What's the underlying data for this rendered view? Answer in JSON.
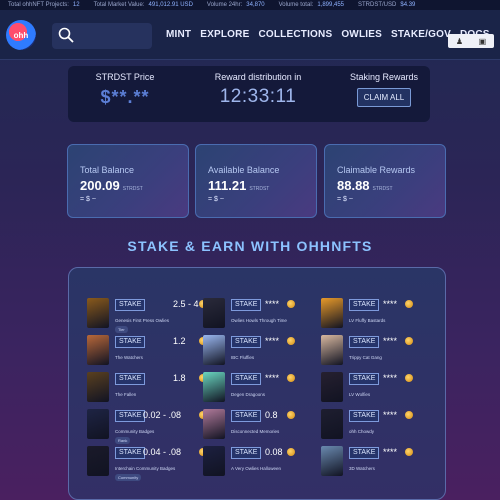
{
  "ticker": {
    "items": [
      {
        "label": "Total ohhNFT Projects:",
        "value": "12"
      },
      {
        "label": "Total Market Value:",
        "value": "491,012.91 USD"
      },
      {
        "label": "Volume 24hr:",
        "value": "34,870"
      },
      {
        "label": "Volume total:",
        "value": "1,899,455"
      },
      {
        "label": "STRDST/USD",
        "value": "$4.39"
      }
    ]
  },
  "header": {
    "logo_text": "ohh",
    "nav": [
      "MINT",
      "EXPLORE",
      "COLLECTIONS",
      "OWLIES",
      "STAKE/GOV",
      "DOCS"
    ],
    "icons": [
      "user-icon",
      "lock-icon"
    ]
  },
  "staking": {
    "price_label": "STRDST Price",
    "price_value": "$**.**",
    "reward_label": "Reward distribution in",
    "reward_value": "12:33:11",
    "rewards_label": "Staking Rewards",
    "claim_label": "CLAIM ALL"
  },
  "balances": [
    {
      "title": "Total Balance",
      "amount": "200.09",
      "unit": "STRDST",
      "usd": "= $ ~"
    },
    {
      "title": "Available Balance",
      "amount": "111.21",
      "unit": "STRDST",
      "usd": "= $ ~"
    },
    {
      "title": "Claimable Rewards",
      "amount": "88.88",
      "unit": "STRDST",
      "usd": "= $ ~"
    }
  ],
  "section_title": "STAKE & EARN WITH OHHNFTS",
  "stake_label": "STAKE",
  "collections": [
    {
      "name": "Genesis First Press Owlies",
      "rate": "2.5 - 4",
      "tag": "Tier",
      "color": "#8a5a1c"
    },
    {
      "name": "The Watchers",
      "rate": "1.2",
      "tag": "",
      "color": "#b8683a"
    },
    {
      "name": "The Fallen",
      "rate": "1.8",
      "tag": "",
      "color": "#5a4020"
    },
    {
      "name": "Community Badges",
      "rate": "0.02 - .08",
      "tag": "Rank",
      "color": "#1e2444"
    },
    {
      "name": "Interchain Community Badges",
      "rate": "0.04 - .08",
      "tag": "Community",
      "color": "#1a1a2a"
    },
    {
      "name": "Owlies Howls Through Time",
      "rate": "****",
      "tag": "",
      "color": "#2a2a3a"
    },
    {
      "name": "IBC Fluffies",
      "rate": "****",
      "tag": "",
      "color": "#9ab7f0"
    },
    {
      "name": "Degen Dragoons",
      "rate": "****",
      "tag": "",
      "color": "#6ad6c0"
    },
    {
      "name": "Disconnected Memories",
      "rate": "0.8",
      "tag": "",
      "color": "#b07a9a"
    },
    {
      "name": "A Very Owlies Halloween",
      "rate": "0.08",
      "tag": "",
      "color": "#1c2040"
    },
    {
      "name": "LV Fluffy Bastards",
      "rate": "****",
      "tag": "",
      "color": "#e89a2a"
    },
    {
      "name": "Trippy Cat Gang",
      "rate": "****",
      "tag": "",
      "color": "#d8b8a0"
    },
    {
      "name": "LV Wolfies",
      "rate": "****",
      "tag": "",
      "color": "#262030"
    },
    {
      "name": "ohh Chowdy",
      "rate": "****",
      "tag": "",
      "color": "#1e1e30"
    },
    {
      "name": "3D Watchers",
      "rate": "****",
      "tag": "",
      "color": "#6a8ab0"
    }
  ]
}
